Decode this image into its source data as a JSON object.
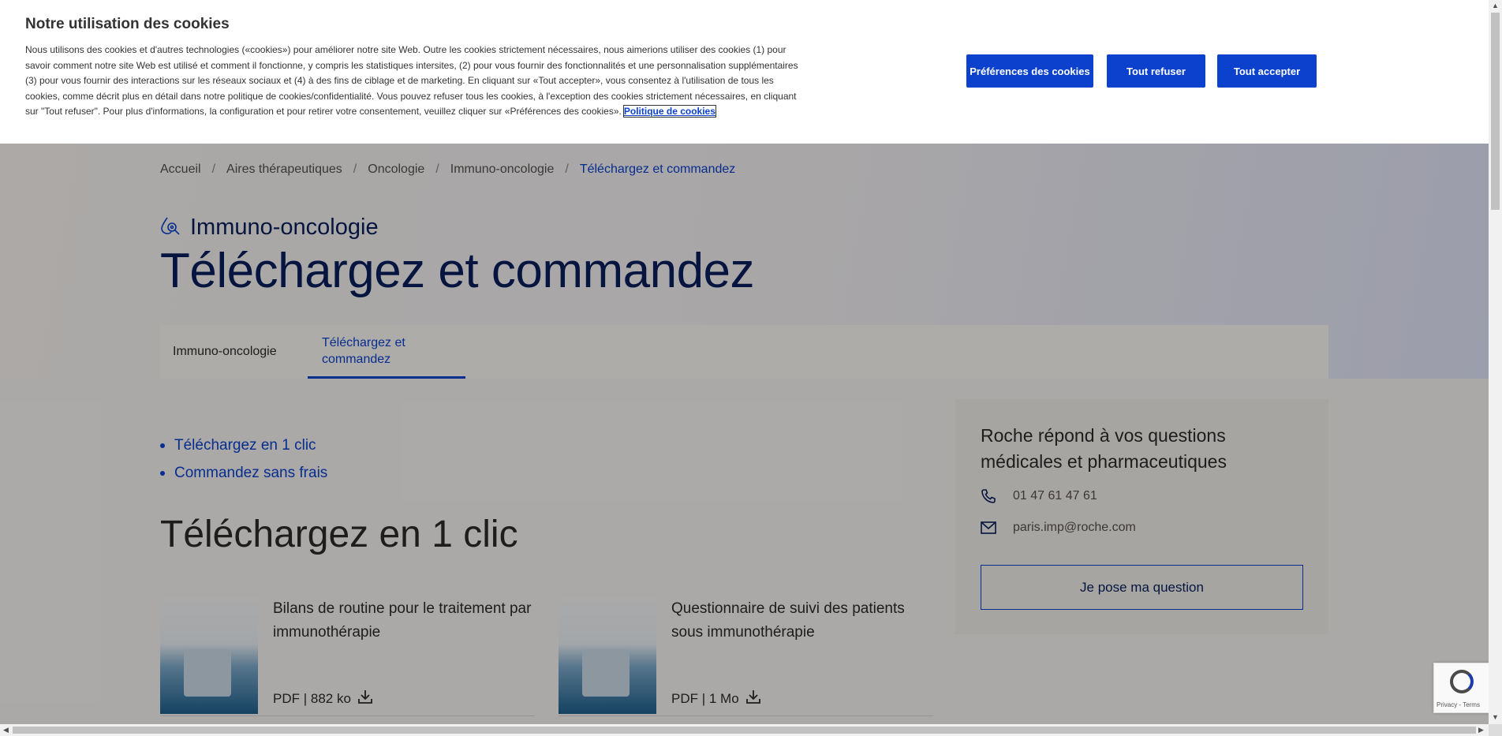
{
  "cookie_banner": {
    "title": "Notre utilisation des cookies",
    "text": "Nous utilisons des cookies et d'autres technologies («cookies») pour améliorer notre site Web. Outre les cookies strictement nécessaires, nous aimerions utiliser des cookies (1) pour savoir comment notre site Web est utilisé et comment il fonctionne, y compris les statistiques intersites, (2) pour vous fournir des fonctionnalités et une personnalisation supplémentaires (3) pour vous fournir des interactions sur les réseaux sociaux et (4) à des fins de ciblage et de marketing. En cliquant sur «Tout accepter», vous consentez à l'utilisation de tous les cookies, comme décrit plus en détail dans notre politique de cookies/confidentialité. Vous pouvez refuser tous les cookies, à l'exception des cookies strictement nécessaires, en cliquant sur \"Tout refuser\". Pour plus d'informations, la configuration et pour retirer votre consentement, veuillez cliquer sur «Préférences des cookies».",
    "policy_link": "Politique de cookies",
    "btn_preferences": "Préférences des cookies",
    "btn_refuse": "Tout refuser",
    "btn_accept": "Tout accepter"
  },
  "breadcrumb": [
    "Accueil",
    "Aires thérapeutiques",
    "Oncologie",
    "Immuno-oncologie",
    "Téléchargez et commandez"
  ],
  "therapy_area": "Immuno-oncologie",
  "page_title": "Téléchargez et commandez",
  "tabs": [
    {
      "label": "Immuno-oncologie",
      "active": false
    },
    {
      "label": "Téléchargez et commandez",
      "active": true
    }
  ],
  "anchor_links": [
    "Téléchargez en 1 clic",
    "Commandez sans frais"
  ],
  "section_title": "Téléchargez en 1 clic",
  "documents": [
    {
      "title": "Bilans de routine pour le traitement par immunothérapie",
      "meta": "PDF | 882 ko"
    },
    {
      "title": "Questionnaire de suivi des patients sous immunothérapie",
      "meta": "PDF | 1 Mo"
    }
  ],
  "contact": {
    "title": "Roche répond à vos questions médicales et pharmaceutiques",
    "phone": "01 47 61 47 61",
    "email": "paris.imp@roche.com",
    "button": "Je pose ma question"
  },
  "recaptcha": {
    "text": "Privacy - Terms"
  },
  "colors": {
    "accent": "#0b41cd",
    "navy": "#0a1f5c"
  }
}
